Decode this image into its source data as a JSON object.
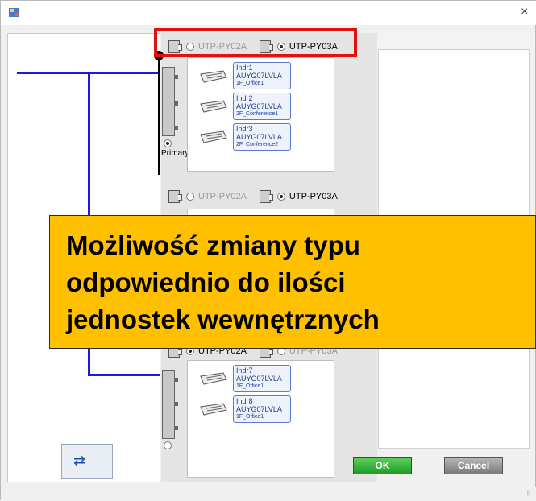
{
  "window": {
    "close_glyph": "×",
    "app_icon": "app-icon"
  },
  "group1": {
    "option_a": "UTP-PY02A",
    "option_b": "UTP-PY03A",
    "selected": "UTP-PY03A",
    "primary_label": "Primary",
    "indoors": [
      {
        "name": "Indr1",
        "model": "AUYG07LVLA",
        "room": "1F_Office1"
      },
      {
        "name": "Indr2",
        "model": "AUYG07LVLA",
        "room": "2F_Conference1"
      },
      {
        "name": "Indr3",
        "model": "AUYG07LVLA",
        "room": "2F_Conference2"
      }
    ]
  },
  "group2": {
    "option_a": "UTP-PY02A",
    "option_b": "UTP-PY03A",
    "selected": "UTP-PY03A"
  },
  "group3": {
    "option_a": "UTP-PY02A",
    "option_b": "UTP-PY03A",
    "selected": "UTP-PY02A",
    "indoors": [
      {
        "name": "Indr7",
        "model": "AUYG07LVLA",
        "room": "1F_Office1"
      },
      {
        "name": "Indr8",
        "model": "AUYG07LVLA",
        "room": "1F_Office1"
      }
    ]
  },
  "callout": {
    "line1": "Możliwość zmiany typu",
    "line2": "odpowiednio do ilości",
    "line3": "jednostek wewnętrznych"
  },
  "buttons": {
    "ok": "OK",
    "cancel": "Cancel",
    "swap_icon": "swap-units-icon"
  },
  "colors": {
    "highlight_border": "#e41010",
    "callout_bg": "#ffc000",
    "ok_bg": "#1f9c24",
    "wire": "#1a1ae0"
  }
}
